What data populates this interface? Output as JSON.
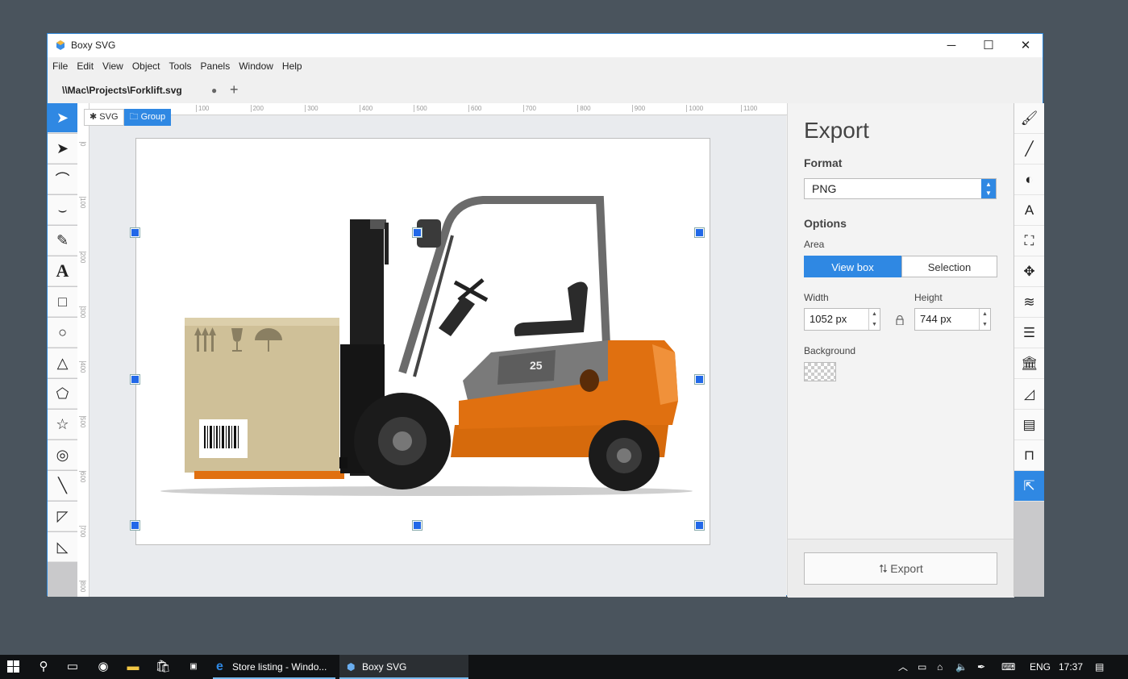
{
  "window": {
    "title": "Boxy SVG",
    "controls": {
      "minimize": "─",
      "maximize": "☐",
      "close": "✕"
    }
  },
  "menu": [
    "File",
    "Edit",
    "View",
    "Object",
    "Tools",
    "Panels",
    "Window",
    "Help"
  ],
  "tabs": [
    {
      "label": "\\\\Mac\\Projects\\Forklift.svg",
      "modified_dot": "●"
    }
  ],
  "add_tab_label": "+",
  "breadcrumbs": [
    {
      "icon": "gear-icon",
      "label": "SVG"
    },
    {
      "icon": "folder-icon",
      "label": "Group"
    }
  ],
  "ruler": {
    "h_ticks": [
      "100",
      "200",
      "300",
      "400",
      "500",
      "600",
      "700",
      "800",
      "900",
      "1000",
      "1100"
    ],
    "v_ticks": [
      "0",
      "100",
      "200",
      "300",
      "400",
      "500",
      "600",
      "700",
      "800"
    ]
  },
  "left_tools": [
    {
      "name": "select-tool",
      "glyph": "➤",
      "active": true
    },
    {
      "name": "edit-tool",
      "glyph": "➤"
    },
    {
      "name": "pen-tool",
      "glyph": "⌒"
    },
    {
      "name": "bezier-tool",
      "glyph": "⌣"
    },
    {
      "name": "pencil-tool",
      "glyph": "✎"
    },
    {
      "name": "text-tool",
      "glyph": "A"
    },
    {
      "name": "rect-tool",
      "glyph": "□"
    },
    {
      "name": "ellipse-tool",
      "glyph": "○"
    },
    {
      "name": "triangle-tool",
      "glyph": "△"
    },
    {
      "name": "polygon-tool",
      "glyph": "⬠"
    },
    {
      "name": "star-tool",
      "glyph": "☆"
    },
    {
      "name": "ring-tool",
      "glyph": "◎"
    },
    {
      "name": "line-tool",
      "glyph": "╲"
    },
    {
      "name": "freeform-tool",
      "glyph": "◸"
    },
    {
      "name": "crop-tool",
      "glyph": "◺"
    }
  ],
  "export_panel": {
    "title": "Export",
    "format_label": "Format",
    "format_value": "PNG",
    "options_label": "Options",
    "area_label": "Area",
    "area_options": [
      "View box",
      "Selection"
    ],
    "area_selected": "View box",
    "width_label": "Width",
    "width_value": "1052 px",
    "height_label": "Height",
    "height_value": "744 px",
    "background_label": "Background",
    "export_button": "⮁ Export"
  },
  "right_tools": [
    {
      "name": "fill-panel",
      "glyph": "🖌"
    },
    {
      "name": "stroke-panel",
      "glyph": "╱"
    },
    {
      "name": "compositing-panel",
      "glyph": "◐"
    },
    {
      "name": "typography-panel",
      "glyph": "A"
    },
    {
      "name": "view-panel",
      "glyph": "⛶"
    },
    {
      "name": "transform-panel",
      "glyph": "✥"
    },
    {
      "name": "layers-panel",
      "glyph": "≋"
    },
    {
      "name": "objects-panel",
      "glyph": "☰"
    },
    {
      "name": "library-panel",
      "glyph": "🏛"
    },
    {
      "name": "gradients-panel",
      "glyph": "◿"
    },
    {
      "name": "comments-panel",
      "glyph": "▤"
    },
    {
      "name": "patterns-panel",
      "glyph": "⊓"
    },
    {
      "name": "export-panel",
      "glyph": "⇱",
      "active": true
    }
  ],
  "taskbar": {
    "apps": [
      {
        "label": "Store listing - Windo...",
        "icon": "edge-icon"
      },
      {
        "label": "Boxy SVG",
        "icon": "boxy-icon",
        "active": true
      }
    ],
    "lang": "ENG",
    "time": "17:37"
  },
  "colors": {
    "accent": "#2f88e3",
    "forklift_orange": "#e07010",
    "handle": "#2168e8"
  }
}
